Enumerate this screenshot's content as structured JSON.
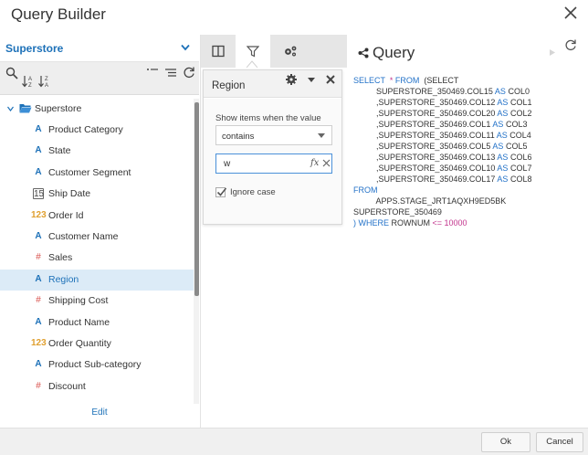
{
  "window": {
    "title": "Query Builder"
  },
  "datasource": {
    "selected": "Superstore"
  },
  "tree": {
    "root": "Superstore",
    "items": [
      {
        "label": "Product Category",
        "type": "text"
      },
      {
        "label": "State",
        "type": "text"
      },
      {
        "label": "Customer Segment",
        "type": "text"
      },
      {
        "label": "Ship Date",
        "type": "date"
      },
      {
        "label": "Order Id",
        "type": "integer"
      },
      {
        "label": "Customer Name",
        "type": "text"
      },
      {
        "label": "Sales",
        "type": "number"
      },
      {
        "label": "Region",
        "type": "text",
        "selected": true
      },
      {
        "label": "Shipping Cost",
        "type": "number"
      },
      {
        "label": "Product Name",
        "type": "text"
      },
      {
        "label": "Order Quantity",
        "type": "integer"
      },
      {
        "label": "Product Sub-category",
        "type": "text"
      },
      {
        "label": "Discount",
        "type": "number"
      }
    ]
  },
  "icons": {
    "text": "A",
    "number": "#",
    "integer": "123",
    "date": "15"
  },
  "left_footer": {
    "edit_label": "Edit"
  },
  "filter": {
    "title": "Region",
    "show_label": "Show items when the value",
    "operator": "contains",
    "value": "w",
    "fx_label": "fx",
    "ignore_case_label": "Ignore case",
    "ignore_case_checked": true
  },
  "query": {
    "title": "Query",
    "lines": [
      [
        [
          "kw",
          "SELECT"
        ],
        [
          "",
          "  "
        ],
        [
          "num",
          "*"
        ],
        [
          "",
          ""
        ],
        [
          "kw",
          " FROM"
        ],
        [
          "",
          ""
        ],
        [
          "",
          "  (SELECT"
        ]
      ],
      [
        [
          "",
          "          SUPERSTORE_350469.COL15 "
        ],
        [
          "kw",
          "AS"
        ],
        [
          "",
          " COL0"
        ]
      ],
      [
        [
          "",
          "          ,SUPERSTORE_350469.COL12 "
        ],
        [
          "kw",
          "AS"
        ],
        [
          "",
          " COL1"
        ]
      ],
      [
        [
          "",
          "          ,SUPERSTORE_350469.COL20 "
        ],
        [
          "kw",
          "AS"
        ],
        [
          "",
          " COL2"
        ]
      ],
      [
        [
          "",
          "          ,SUPERSTORE_350469.COL1 "
        ],
        [
          "kw",
          "AS"
        ],
        [
          "",
          " COL3"
        ]
      ],
      [
        [
          "",
          "          ,SUPERSTORE_350469.COL11 "
        ],
        [
          "kw",
          "AS"
        ],
        [
          "",
          " COL4"
        ]
      ],
      [
        [
          "",
          "          ,SUPERSTORE_350469.COL5 "
        ],
        [
          "kw",
          "AS"
        ],
        [
          "",
          " COL5"
        ]
      ],
      [
        [
          "",
          "          ,SUPERSTORE_350469.COL13 "
        ],
        [
          "kw",
          "AS"
        ],
        [
          "",
          " COL6"
        ]
      ],
      [
        [
          "",
          "          ,SUPERSTORE_350469.COL10 "
        ],
        [
          "kw",
          "AS"
        ],
        [
          "",
          " COL7"
        ]
      ],
      [
        [
          "",
          "          ,SUPERSTORE_350469.COL17 "
        ],
        [
          "kw",
          "AS"
        ],
        [
          "",
          " COL8"
        ]
      ],
      [
        [
          "kw",
          "FROM"
        ]
      ],
      [
        [
          "",
          "          APPS.STAGE_JRT1AQXH9ED5BK"
        ]
      ],
      [
        [
          "",
          "SUPERSTORE_350469"
        ]
      ],
      [
        [
          "kw",
          ") WHERE"
        ],
        [
          "",
          " ROWNUM "
        ],
        [
          "num",
          "<="
        ],
        [
          "",
          ""
        ],
        [
          "num",
          " 10000"
        ]
      ]
    ]
  },
  "footer": {
    "ok_label": "Ok",
    "cancel_label": "Cancel"
  },
  "colors": {
    "accent": "#1d71b8",
    "keyword": "#2372c8",
    "literal": "#c2338c",
    "selected_row": "#dcebf7"
  }
}
